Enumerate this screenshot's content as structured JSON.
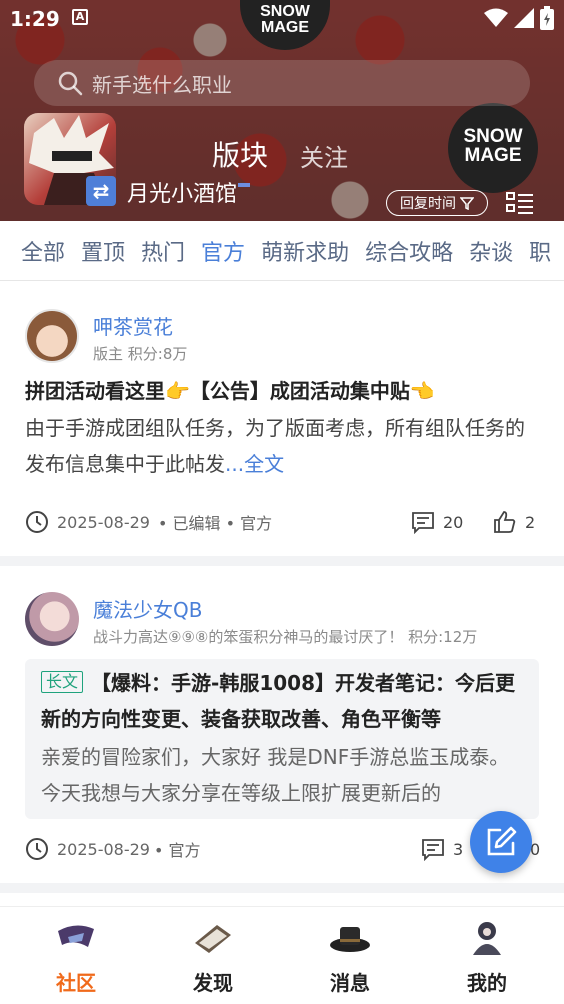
{
  "status_bar": {
    "time": "1:29",
    "notification_letter": "A"
  },
  "search": {
    "placeholder": "新手选什么职业"
  },
  "board": {
    "name": "月光小酒馆",
    "tabs": [
      "版块",
      "关注"
    ],
    "reply_sort_label": "回复时间",
    "banner_text": [
      "SNOW",
      "MAGE"
    ]
  },
  "categories": {
    "items": [
      "全部",
      "置顶",
      "热门",
      "官方",
      "萌新求助",
      "综合攻略",
      "杂谈",
      "职"
    ],
    "active_index": 3
  },
  "posts": [
    {
      "author": "呷茶赏花",
      "author_meta": "版主  积分:8万",
      "title": "拼团活动看这里👉【公告】成团活动集中贴👈",
      "body": " 由于手游成团组队任务，为了版面考虑，所有组队任务的发布信息集中于此帖发",
      "more": "...全文",
      "date": "2025-08-29",
      "tags": "• 已编辑 • 官方",
      "comments": "20",
      "likes": "2"
    },
    {
      "author": "魔法少女QB",
      "author_meta": "战斗力高达⑨⑨⑧的笨蛋积分神马的最讨厌了！  积分:12万",
      "long_tag": "长文",
      "title": "【爆料：手游-韩服1008】开发者笔记：今后更新的方向性变更、装备获取改善、角色平衡等",
      "body": "亲爱的冒险家们，大家好 我是DNF手游总监玉成泰。 今天我想与大家分享在等级上限扩展更新后的",
      "date": "2025-08-29",
      "tags": "• 官方",
      "comments": "3",
      "likes": "0"
    }
  ],
  "bottom_nav": {
    "items": [
      "社区",
      "发现",
      "消息",
      "我的"
    ],
    "active_index": 0
  },
  "colors": {
    "accent": "#4a7fd8",
    "active_nav": "#f06a1b",
    "long_tag": "#1fa37d",
    "fab": "#3f82e8"
  }
}
